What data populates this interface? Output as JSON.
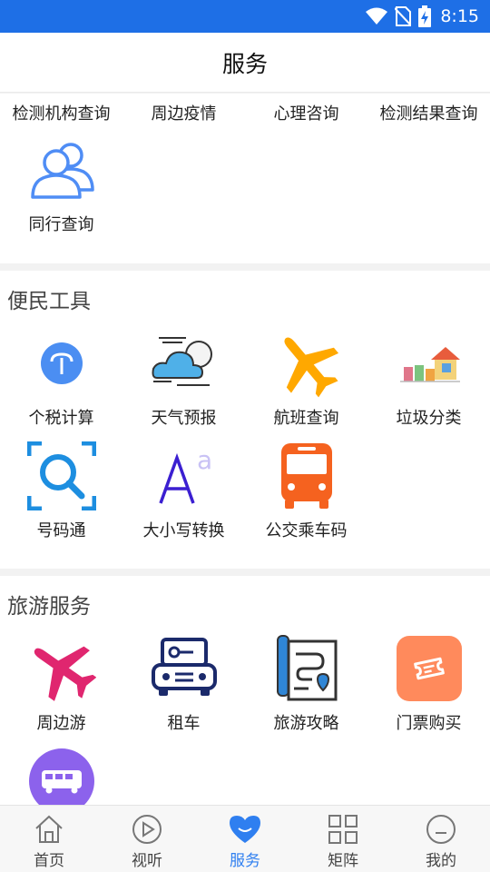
{
  "status_bar": {
    "time": "8:15"
  },
  "header": {
    "title": "服务"
  },
  "top_links": [
    "检测机构查询",
    "周边疫情",
    "心理咨询",
    "检测结果查询"
  ],
  "top_tools": [
    {
      "label": "同行查询",
      "icon": "people-icon"
    }
  ],
  "convenience": {
    "title": "便民工具",
    "items": [
      {
        "label": "个税计算",
        "icon": "tax-icon"
      },
      {
        "label": "天气预报",
        "icon": "weather-icon"
      },
      {
        "label": "航班查询",
        "icon": "flight-icon"
      },
      {
        "label": "垃圾分类",
        "icon": "trash-sort-icon"
      },
      {
        "label": "号码通",
        "icon": "number-search-icon"
      },
      {
        "label": "大小写转换",
        "icon": "case-convert-icon"
      },
      {
        "label": "公交乘车码",
        "icon": "bus-icon"
      }
    ]
  },
  "travel": {
    "title": "旅游服务",
    "items": [
      {
        "label": "周边游",
        "icon": "plane-icon"
      },
      {
        "label": "租车",
        "icon": "car-icon"
      },
      {
        "label": "旅游攻略",
        "icon": "map-guide-icon"
      },
      {
        "label": "门票购买",
        "icon": "ticket-icon"
      },
      {
        "label": "",
        "icon": "bus-badge-icon"
      }
    ]
  },
  "tabs": [
    {
      "label": "首页",
      "icon": "home-icon",
      "active": false
    },
    {
      "label": "视听",
      "icon": "play-icon",
      "active": false
    },
    {
      "label": "服务",
      "icon": "heart-icon",
      "active": true
    },
    {
      "label": "矩阵",
      "icon": "grid-icon",
      "active": false
    },
    {
      "label": "我的",
      "icon": "profile-icon",
      "active": false
    }
  ],
  "colors": {
    "status_bar": "#1e6fe6",
    "accent": "#2f7ff0",
    "flight_orange": "#ffa800",
    "bus_orange": "#f5621f",
    "plane_pink": "#e0266f",
    "ticket_orange": "#ff8a5c",
    "purple": "#8c62ec"
  }
}
